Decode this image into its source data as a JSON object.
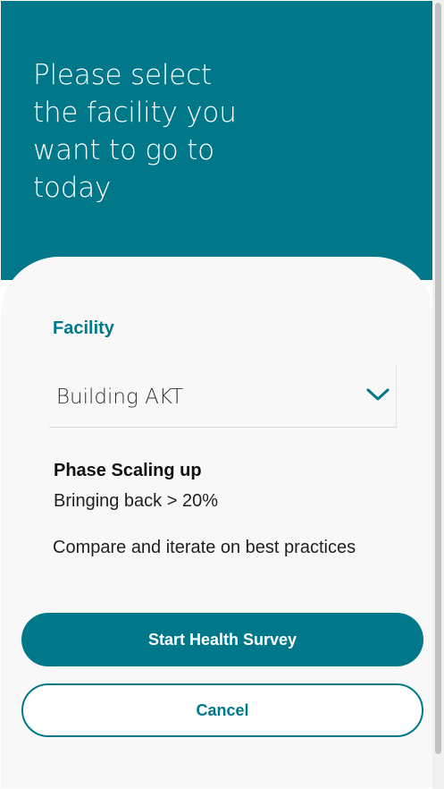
{
  "header": {
    "title": "Please select the facility you want to go to today"
  },
  "form": {
    "facility_label": "Facility",
    "facility_value": "Building AKT",
    "dropdown_icon": "chevron-down-icon"
  },
  "phase": {
    "title": "Phase Scaling up",
    "value": "Bringing back > 20%",
    "description": "Compare and iterate on best practices"
  },
  "actions": {
    "start_label": "Start Health Survey",
    "cancel_label": "Cancel"
  },
  "colors": {
    "brand": "#00788a",
    "card_bg": "#f8f8f8"
  }
}
